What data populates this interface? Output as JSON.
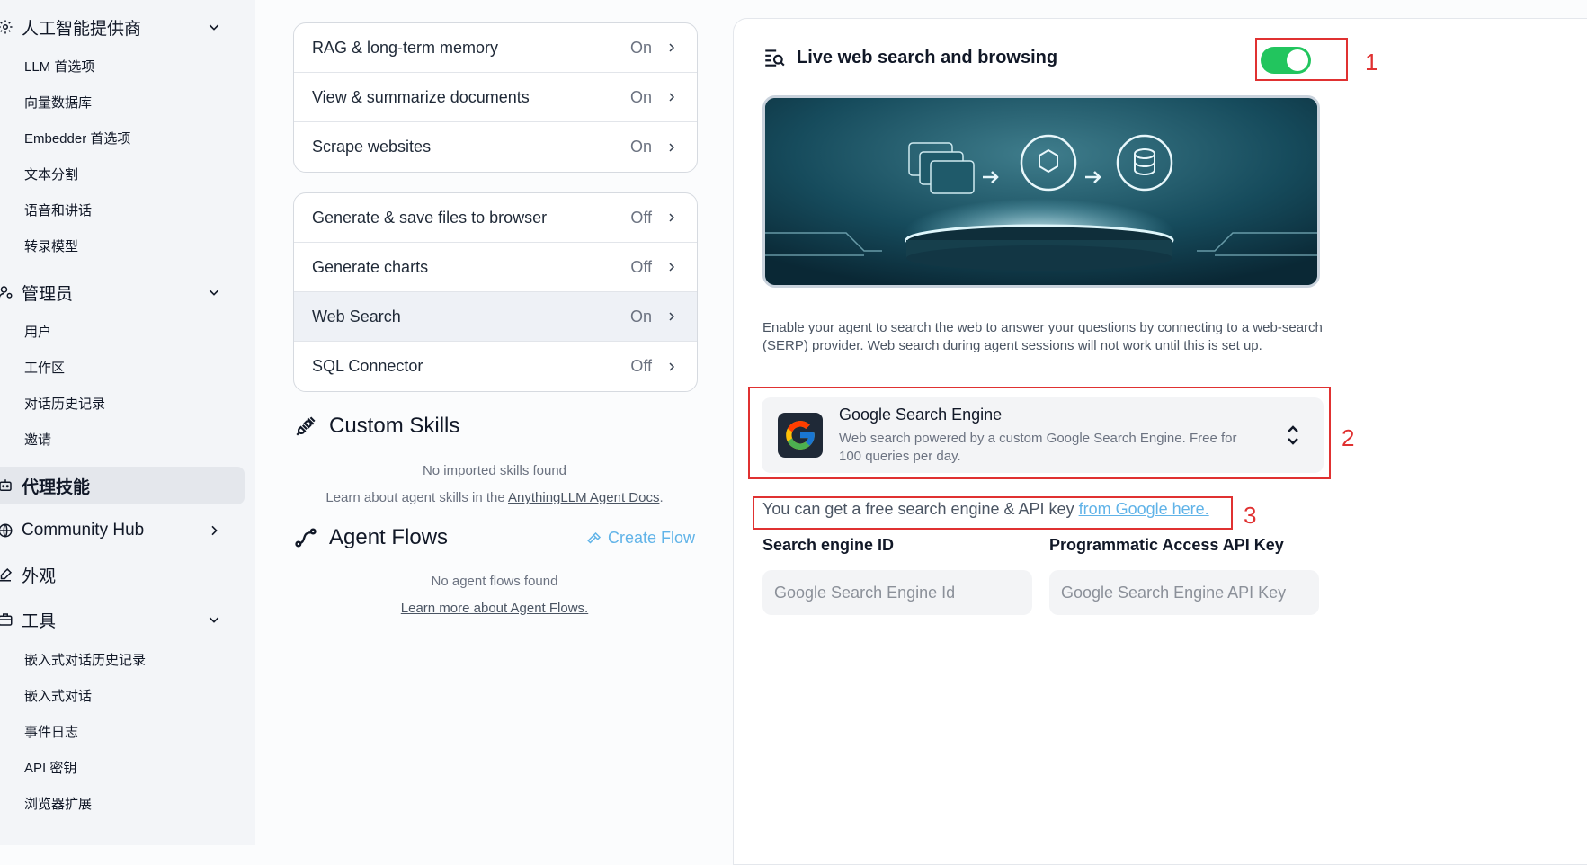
{
  "sidebar": {
    "groups": {
      "ai_providers": {
        "label": "人工智能提供商",
        "items": [
          "LLM 首选项",
          "向量数据库",
          "Embedder 首选项",
          "文本分割",
          "语音和讲话",
          "转录模型"
        ]
      },
      "admin": {
        "label": "管理员",
        "items": [
          "用户",
          "工作区",
          "对话历史记录",
          "邀请"
        ]
      },
      "agent_skills": {
        "label": "代理技能"
      },
      "community_hub": {
        "label": "Community Hub"
      },
      "appearance": {
        "label": "外观"
      },
      "tools": {
        "label": "工具",
        "items": [
          "嵌入式对话历史记录",
          "嵌入式对话",
          "事件日志",
          "API 密钥",
          "浏览器扩展"
        ]
      }
    }
  },
  "skills": {
    "group1": [
      {
        "label": "RAG & long-term memory",
        "state": "On"
      },
      {
        "label": "View & summarize documents",
        "state": "On"
      },
      {
        "label": "Scrape websites",
        "state": "On"
      }
    ],
    "group2": [
      {
        "label": "Generate & save files to browser",
        "state": "Off"
      },
      {
        "label": "Generate charts",
        "state": "Off"
      },
      {
        "label": "Web Search",
        "state": "On"
      },
      {
        "label": "SQL Connector",
        "state": "Off"
      }
    ]
  },
  "custom_skills": {
    "title": "Custom Skills",
    "empty": "No imported skills found",
    "learn_prefix": "Learn about agent skills in the ",
    "learn_link": "AnythingLLM Agent Docs",
    "learn_suffix": "."
  },
  "agent_flows": {
    "title": "Agent Flows",
    "create": "Create Flow",
    "empty": "No agent flows found",
    "learn_link": "Learn more about Agent Flows."
  },
  "web_search": {
    "title": "Live web search and browsing",
    "enabled": true,
    "description": "Enable your agent to search the web to answer your questions by connecting to a web-search (SERP) provider. Web search during agent sessions will not work until this is set up.",
    "provider": {
      "name": "Google Search Engine",
      "description": "Web search powered by a custom Google Search Engine. Free for 100 queries per day."
    },
    "api_note_prefix": "You can get a free search engine & API key ",
    "api_note_link": "from Google here.",
    "fields": {
      "engine_id": {
        "label": "Search engine ID",
        "placeholder": "Google Search Engine Id"
      },
      "api_key": {
        "label": "Programmatic Access API Key",
        "placeholder": "Google Search Engine API Key"
      }
    }
  },
  "annotations": [
    "1",
    "2",
    "3"
  ],
  "colors": {
    "accent": "#22c55e",
    "link": "#60b3e8",
    "annotation": "#e03131"
  }
}
